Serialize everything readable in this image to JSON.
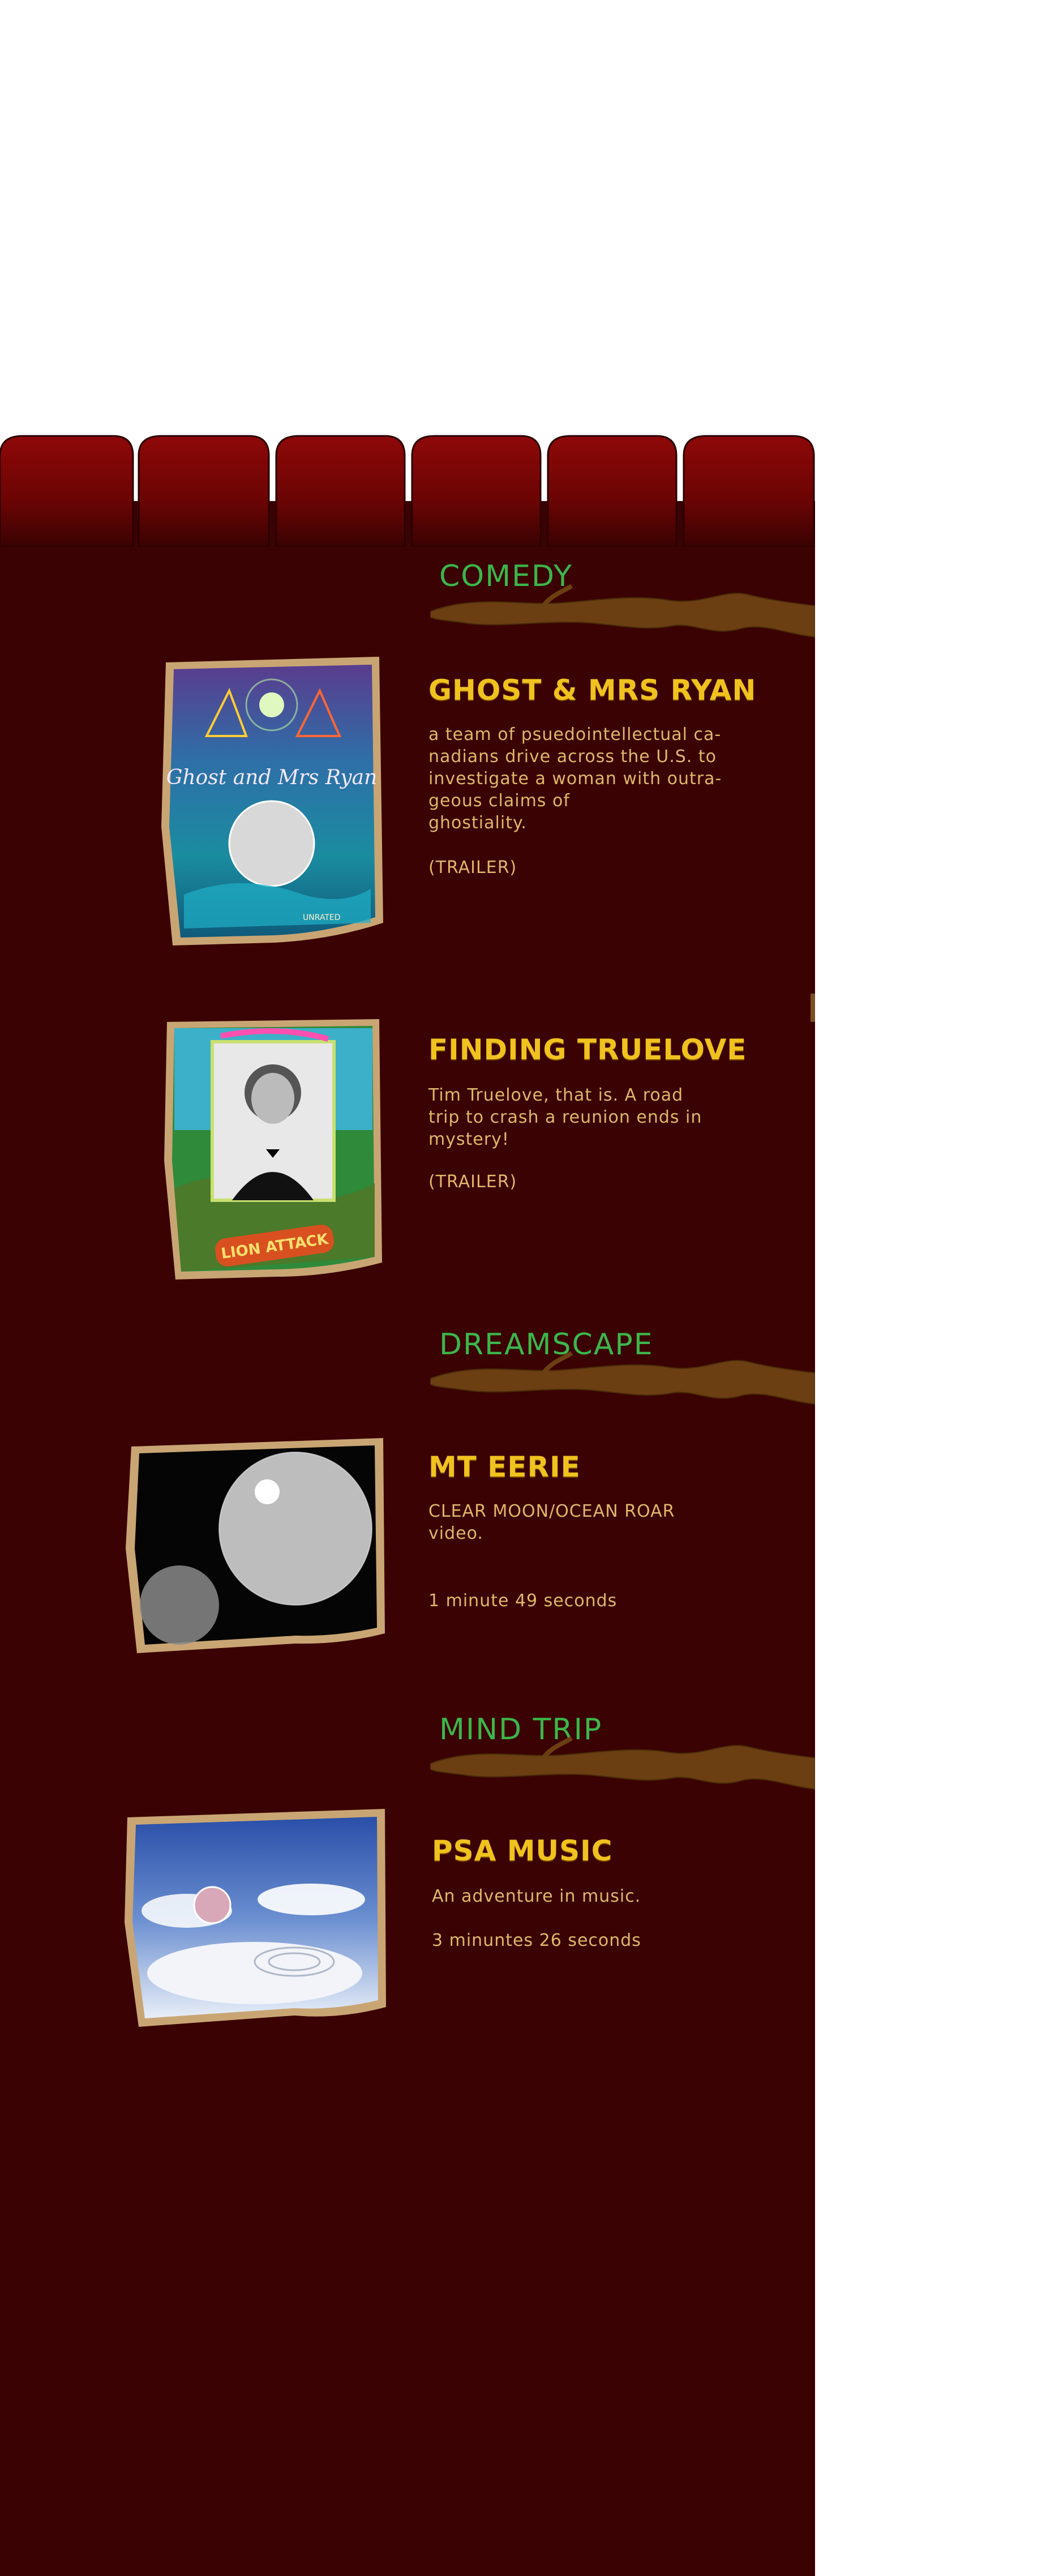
{
  "sections": {
    "comedy": {
      "title": "COMEDY"
    },
    "dreamscape": {
      "title": "DREAMSCAPE"
    },
    "mindtrip": {
      "title": "MIND TRIP"
    }
  },
  "films": {
    "ghost": {
      "title": "GHOST & MRS RYAN",
      "desc_lines": [
        "a team of psuedointellectual ca-",
        "nadians drive across the U.S. to",
        "investigate a woman with outra-",
        "geous claims of",
        "ghostiality."
      ],
      "trailer": "(TRAILER)",
      "poster_text": "Ghost and Mrs Ryan"
    },
    "truelove": {
      "title": "FINDING TRUELOVE",
      "desc_lines": [
        "Tim Truelove, that is.  A road",
        "trip to crash a reunion ends in",
        "mystery!"
      ],
      "trailer": "(TRAILER)",
      "poster_text": "LION ATTACK"
    },
    "eerie": {
      "title": "MT EERIE",
      "desc_lines": [
        "CLEAR MOON/OCEAN ROAR",
        "video."
      ],
      "duration": "1 minute 49 seconds"
    },
    "psa": {
      "title": "PSA MUSIC",
      "desc_lines": [
        "An adventure in music."
      ],
      "duration": "3 minuntes 26 seconds"
    }
  },
  "colors": {
    "background": "#3a0202",
    "curtain": "#7a0606",
    "section_title": "#3cb64a",
    "film_title": "#f0c21e",
    "body_text": "#e0b66a",
    "branch": "#6b3f12"
  }
}
